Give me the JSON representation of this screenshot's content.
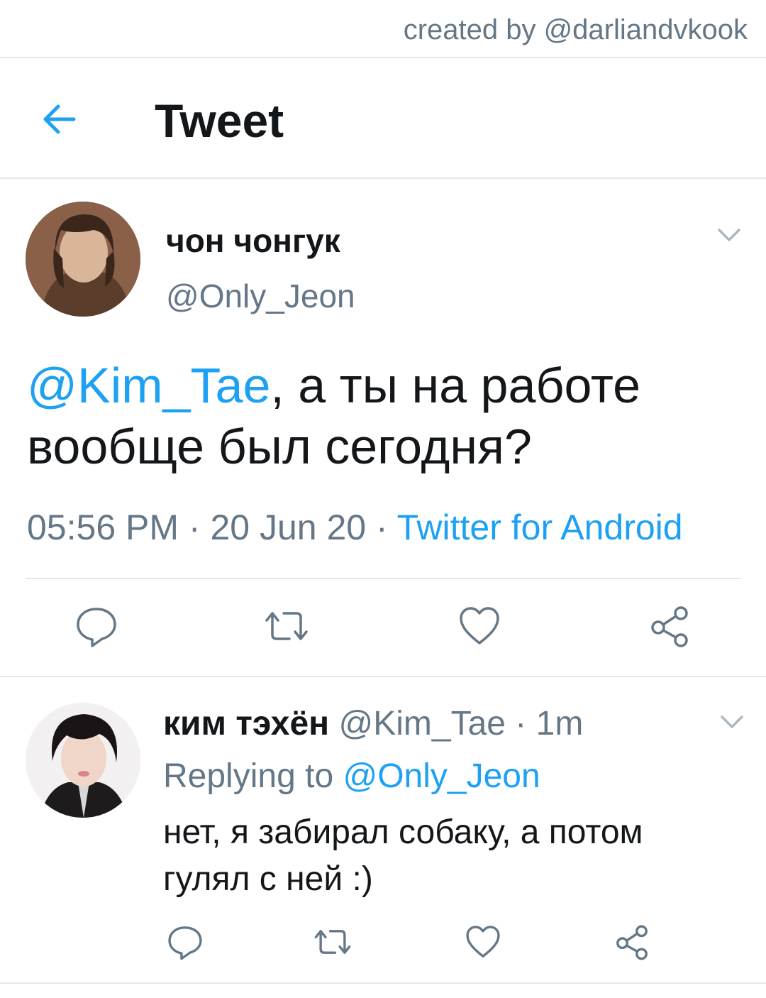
{
  "credit": {
    "text": "created by @darliandvkook"
  },
  "header": {
    "title": "Tweet",
    "back_icon": "arrow-left-icon"
  },
  "colors": {
    "accent": "#1da1f2",
    "secondary_text": "#657786",
    "primary_text": "#14171a",
    "divider": "#e1e8ed"
  },
  "main_tweet": {
    "name": "чон чонгук",
    "handle": "@Only_Jeon",
    "mention": "@Kim_Tae",
    "text_rest": ", а ты на работе вообще был сегодня?",
    "time": "05:56 PM",
    "sep1": " · ",
    "date": "20 Jun 20",
    "sep2": " · ",
    "source": "Twitter for Android"
  },
  "reply_tweet": {
    "name": "ким тэхён",
    "handle": "@Kim_Tae",
    "sep": " · ",
    "time": "1m",
    "replying_label": "Replying to ",
    "replying_to": "@Only_Jeon",
    "text": "нет, я забирал собаку, а потом гулял с ней :)"
  }
}
